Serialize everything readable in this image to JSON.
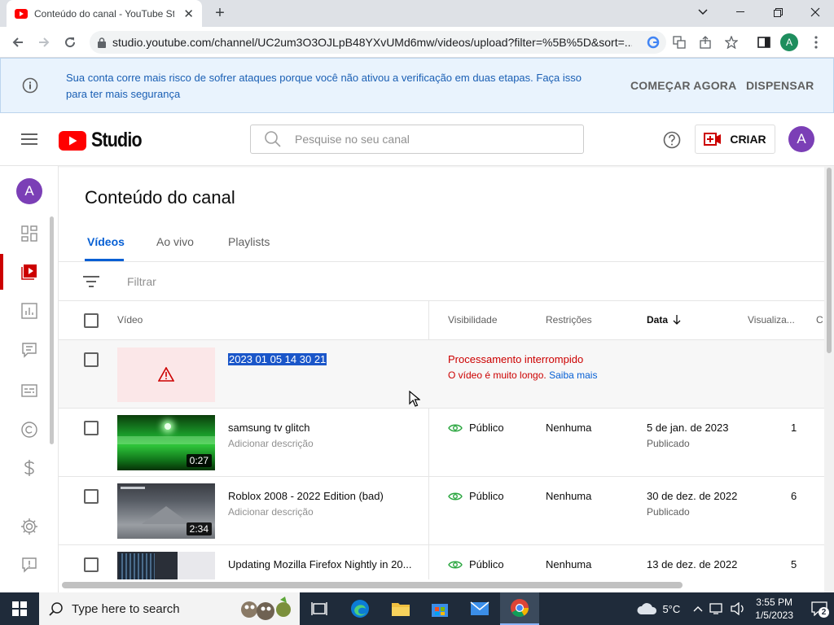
{
  "browser": {
    "tab_title": "Conteúdo do canal - YouTube Studio",
    "url": "studio.youtube.com/channel/UC2um3O3OJLpB48YXvUMd6mw/videos/upload?filter=%5B%5D&sort=...",
    "profile_initial": "A"
  },
  "banner": {
    "message": "Sua conta corre mais risco de sofrer ataques porque você não ativou a verificação em duas etapas. Faça isso para ter mais segurança",
    "start_label": "COMEÇAR AGORA",
    "dismiss_label": "DISPENSAR"
  },
  "header": {
    "logo_text": "Studio",
    "search_placeholder": "Pesquise no seu canal",
    "create_label": "CRIAR",
    "avatar_initial": "A"
  },
  "sidebar": {
    "avatar_initial": "A"
  },
  "content": {
    "title": "Conteúdo do canal",
    "tabs": [
      "Vídeos",
      "Ao vivo",
      "Playlists"
    ],
    "filter_placeholder": "Filtrar",
    "columns": {
      "video": "Vídeo",
      "visibility": "Visibilidade",
      "restrictions": "Restrições",
      "date": "Data",
      "views": "Visualiza...",
      "comments": "C"
    }
  },
  "rows": [
    {
      "title": "2023 01 05 14 30 21",
      "error_title": "Processamento interrompido",
      "error_detail": "O vídeo é muito longo.",
      "learn_more": "Saiba mais"
    },
    {
      "title": "samsung tv glitch",
      "description": "Adicionar descrição",
      "duration": "0:27",
      "visibility": "Público",
      "restrictions": "Nenhuma",
      "date": "5 de jan. de 2023",
      "status": "Publicado",
      "views": "1"
    },
    {
      "title": "Roblox 2008 - 2022 Edition (bad)",
      "description": "Adicionar descrição",
      "duration": "2:34",
      "visibility": "Público",
      "restrictions": "Nenhuma",
      "date": "30 de dez. de 2022",
      "status": "Publicado",
      "views": "6"
    },
    {
      "title": "Updating Mozilla Firefox Nightly in 20...",
      "visibility": "Público",
      "restrictions": "Nenhuma",
      "date": "13 de dez. de 2022",
      "views": "5"
    }
  ],
  "taskbar": {
    "search_placeholder": "Type here to search",
    "temperature": "5°C",
    "time": "3:55 PM",
    "date": "1/5/2023",
    "notification_count": "2"
  },
  "colors": {
    "accent_blue": "#065fd4",
    "youtube_red": "#ff0000",
    "error_red": "#cc0000",
    "banner_bg": "#e9f3fd",
    "avatar_purple": "#7b3fb6",
    "taskbar": "#1f2b3a"
  }
}
